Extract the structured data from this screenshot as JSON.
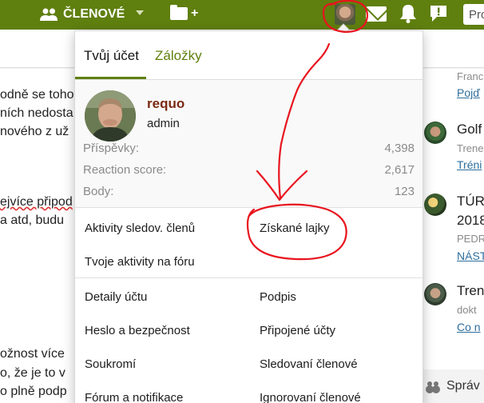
{
  "topbar": {
    "members_label": "ČLENOVÉ",
    "new_label": "+",
    "search_placeholder": "Pro"
  },
  "background": {
    "lines": [
      "odně se toho",
      "ních nedosta",
      "nového z už",
      "ejvíce připod",
      "a atd, budu",
      "ožnost více ",
      "o, že je to v",
      "o plně podp"
    ],
    "sidebar": {
      "line1": "Franc",
      "link1": "Pojď",
      "item2_title": "Golf",
      "item2_sub": "Trene",
      "item2_link": "Tréni",
      "item3_title": "TÚRA",
      "item3_year": "2018",
      "item3_sub": "PEDR",
      "item3_link": "NÁST",
      "item4_title": "Tren",
      "item4_sub": "dokt",
      "item4_link": "Co n",
      "bottom_label": "Správ"
    }
  },
  "popup": {
    "tabs": {
      "account": "Tvůj účet",
      "bookmarks": "Záložky"
    },
    "user": {
      "name": "requo",
      "role": "admin"
    },
    "stats": [
      {
        "label": "Příspěvky:",
        "value": "4,398"
      },
      {
        "label": "Reaction score:",
        "value": "2,617"
      },
      {
        "label": "Body:",
        "value": "123"
      }
    ],
    "menu": {
      "followed_activity": "Aktivity sledov. členů",
      "likes_received": "Získané lajky",
      "your_activity": "Tvoje aktivity na fóru",
      "account_details": "Detaily účtu",
      "signature": "Podpis",
      "password_security": "Heslo a bezpečnost",
      "connected_accounts": "Připojené účty",
      "privacy": "Soukromí",
      "following": "Sledovaní členové",
      "forum_notifications": "Fórum a notifikace",
      "ignored": "Ignorovaní členové"
    }
  },
  "colors": {
    "brand_green": "#5f7f0f",
    "username": "#7a2a12",
    "annotation_red": "#e8141e"
  }
}
